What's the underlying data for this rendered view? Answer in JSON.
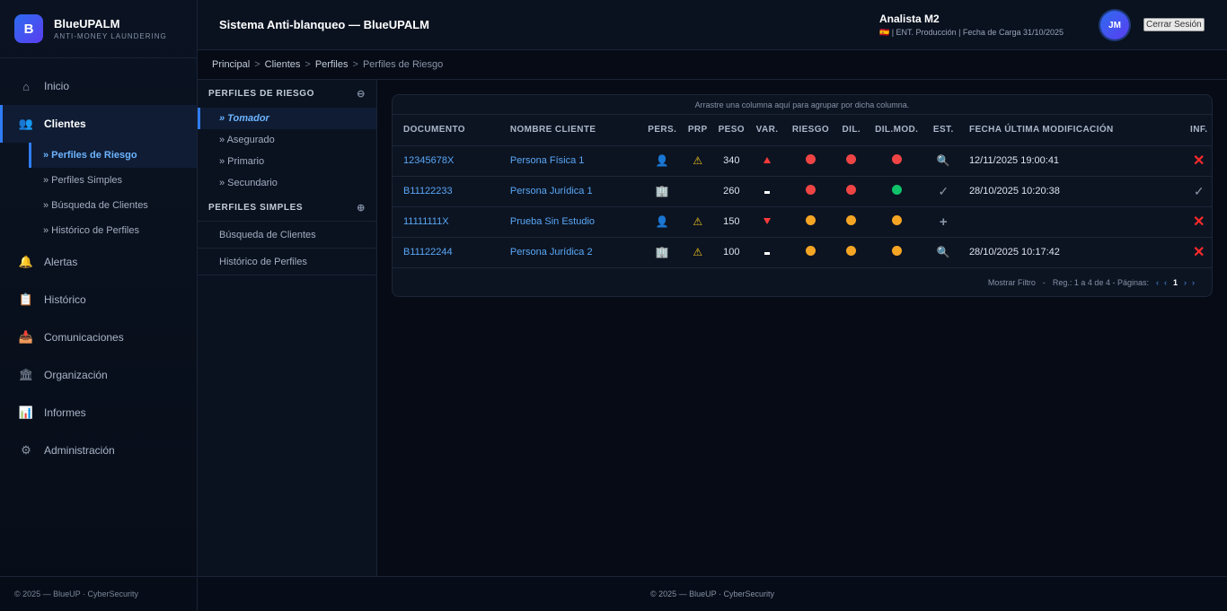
{
  "brand": {
    "name": "BlueUPALM",
    "subtitle": "ANTI-MONEY LAUNDERING",
    "logo": "B"
  },
  "sidebar": {
    "items": [
      {
        "label": "Inicio",
        "icon": "home-icon"
      },
      {
        "label": "Clientes",
        "icon": "users-icon"
      },
      {
        "label": "Alertas",
        "icon": "bell-icon"
      },
      {
        "label": "Histórico",
        "icon": "clipboard-icon"
      },
      {
        "label": "Comunicaciones",
        "icon": "inbox-icon"
      },
      {
        "label": "Organización",
        "icon": "bank-icon"
      },
      {
        "label": "Informes",
        "icon": "chart-icon"
      },
      {
        "label": "Administración",
        "icon": "gear-icon"
      }
    ],
    "subitems": [
      "» Perfiles de Riesgo",
      "» Perfiles Simples",
      "» Búsqueda de Clientes",
      "» Histórico de Perfiles"
    ],
    "footer": "© 2025 — BlueUP · CyberSecurity"
  },
  "header": {
    "title": "Sistema Anti-blanqueo — BlueUPALM",
    "user_name": "Analista M2",
    "user_info": "🇪🇸 | ENT. Producción | Fecha de Carga 31/10/2025",
    "avatar": "JM",
    "logout": "Cerrar Sesión"
  },
  "breadcrumb": [
    "Principal",
    "Clientes",
    "Perfiles",
    "Perfiles de Riesgo"
  ],
  "subpanel": {
    "riesgo_title": "PERFILES DE RIESGO",
    "riesgo_items": [
      "» Tomador",
      "» Asegurado",
      "» Primario",
      "» Secundario"
    ],
    "simples_title": "PERFILES SIMPLES",
    "links": [
      "Búsqueda de Clientes",
      "Histórico de Perfiles"
    ]
  },
  "grid": {
    "group_hint": "Arrastre una columna aquí para agrupar por dicha columna.",
    "columns": [
      "DOCUMENTO",
      "NOMBRE CLIENTE",
      "PERS.",
      "PRP",
      "PESO",
      "VAR.",
      "RIESGO",
      "DIL.",
      "DIL.MOD.",
      "EST.",
      "FECHA ÚLTIMA MODIFICACIÓN",
      "INF."
    ],
    "rows": [
      {
        "documento": "12345678X",
        "nombre": "Persona Física 1",
        "pers": "person",
        "prp": true,
        "peso": "340",
        "var": "up",
        "riesgo": "red",
        "dil": "red",
        "dilmod": "red",
        "est": "search",
        "fecha": "12/11/2025 19:00:41",
        "inf": "x"
      },
      {
        "documento": "B11122233",
        "nombre": "Persona Jurídica 1",
        "pers": "building",
        "prp": false,
        "peso": "260",
        "var": "flat",
        "riesgo": "red",
        "dil": "red",
        "dilmod": "green",
        "est": "check",
        "fecha": "28/10/2025 10:20:38",
        "inf": "check"
      },
      {
        "documento": "11111111X",
        "nombre": "Prueba Sin Estudio",
        "pers": "person",
        "prp": true,
        "peso": "150",
        "var": "down",
        "riesgo": "orange",
        "dil": "orange",
        "dilmod": "orange",
        "est": "plus",
        "fecha": "",
        "inf": "x"
      },
      {
        "documento": "B11122244",
        "nombre": "Persona Jurídica 2",
        "pers": "building",
        "prp": true,
        "peso": "100",
        "var": "flat",
        "riesgo": "orange",
        "dil": "orange",
        "dilmod": "orange",
        "est": "search",
        "fecha": "28/10/2025 10:17:42",
        "inf": "x"
      }
    ],
    "footer": {
      "filter": "Mostrar Filtro",
      "records": "Reg.: 1 a 4 de 4 - Páginas:",
      "page": "1"
    }
  },
  "colors": {
    "red": "#ef4444",
    "orange": "#f5a524",
    "green": "#10c26a",
    "accent": "#2f7cf6"
  },
  "footer": "© 2025 — BlueUP · CyberSecurity"
}
